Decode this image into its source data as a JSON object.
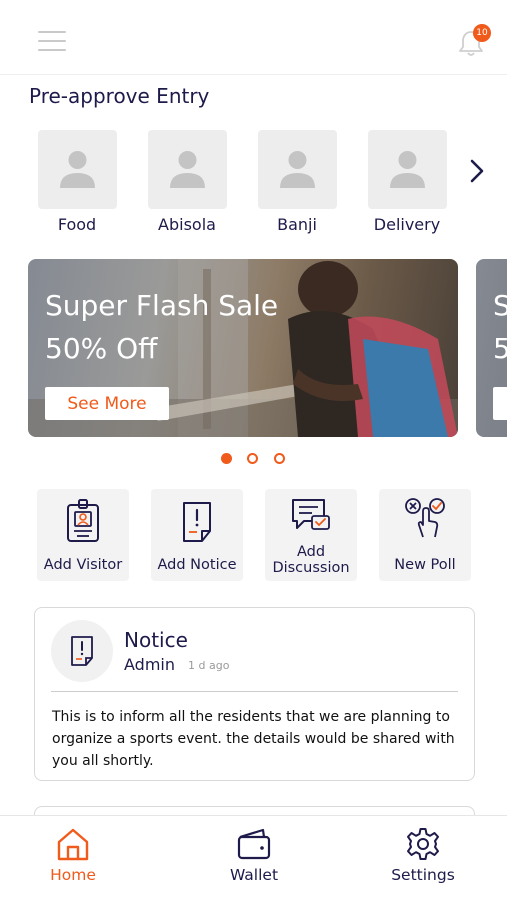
{
  "header": {
    "menu_icon": "hamburger-icon",
    "bell_icon": "bell-icon",
    "notification_count": "10"
  },
  "preapprove": {
    "title": "Pre-approve Entry",
    "contacts": [
      {
        "label": "Food",
        "icon": "person-icon"
      },
      {
        "label": "Abisola",
        "icon": "person-icon"
      },
      {
        "label": "Banji",
        "icon": "person-icon"
      },
      {
        "label": "Delivery",
        "icon": "person-icon"
      }
    ],
    "next_icon": "chevron-right-icon"
  },
  "banner": {
    "title": "Super Flash Sale",
    "subtitle": "50% Off",
    "button_label": "See More",
    "peek_title": "S",
    "peek_subtitle": "5"
  },
  "carousel": {
    "active_index": 0,
    "count": 3
  },
  "actions": [
    {
      "label": "Add Visitor",
      "icon": "visitor-badge-icon"
    },
    {
      "label": "Add Notice",
      "icon": "notice-doc-icon"
    },
    {
      "label": "Add Discussion",
      "icon": "discussion-chat-icon"
    },
    {
      "label": "New Poll",
      "icon": "poll-hand-icon"
    }
  ],
  "notice": {
    "icon": "notice-doc-icon",
    "title": "Notice",
    "author": "Admin",
    "time": "1 d ago",
    "body": "This is to inform all the residents that we are planning to organize a sports event. the details would be shared with you all shortly."
  },
  "bottom_nav": [
    {
      "label": "Home",
      "icon": "home-icon",
      "active": true
    },
    {
      "label": "Wallet",
      "icon": "wallet-icon",
      "active": false
    },
    {
      "label": "Settings",
      "icon": "gear-icon",
      "active": false
    }
  ],
  "colors": {
    "accent": "#f05a1a",
    "text": "#1e1b4b",
    "tile": "#f3f3f3"
  }
}
